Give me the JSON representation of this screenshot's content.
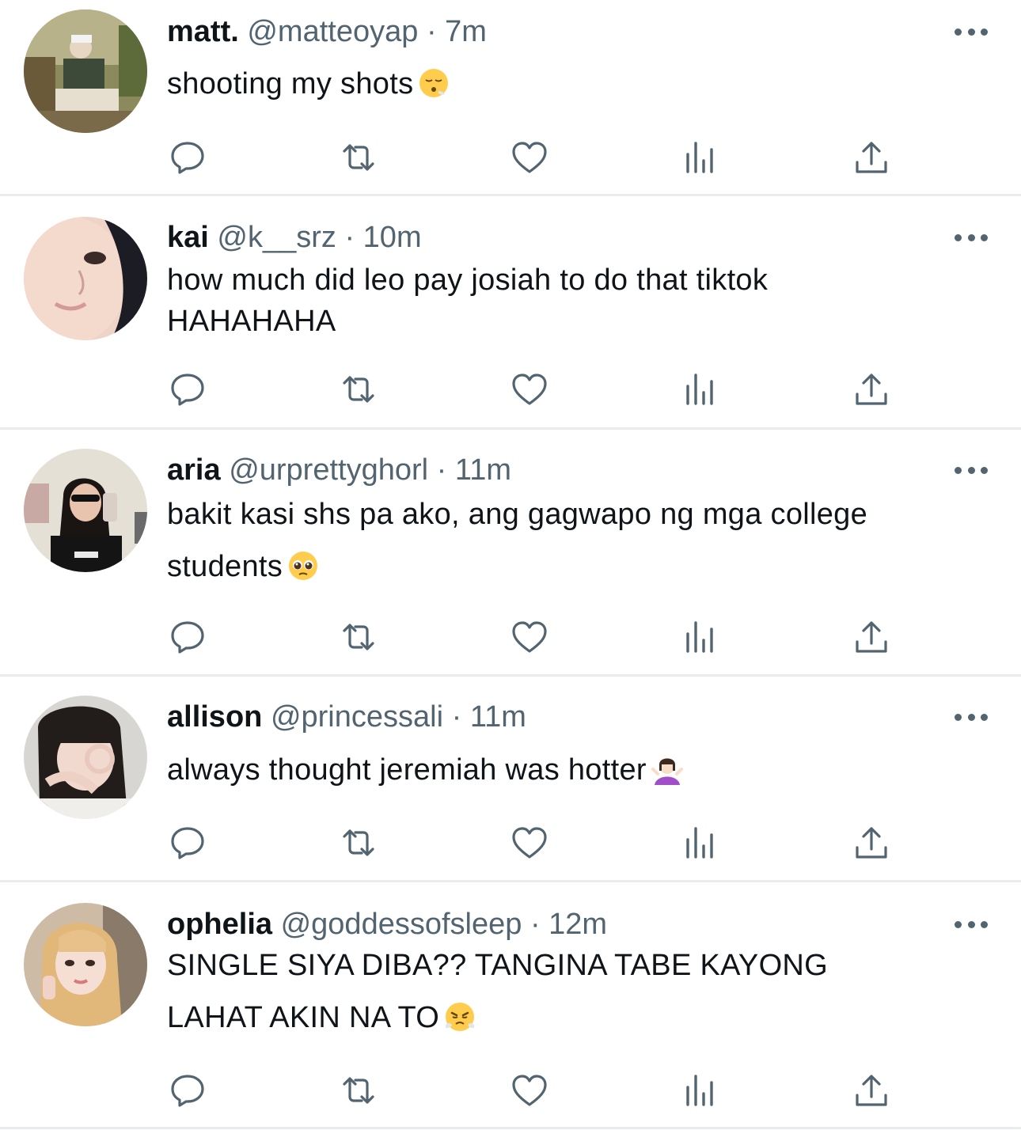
{
  "tweets": [
    {
      "name": "matt.",
      "handle": "@matteoyap",
      "separator": "·",
      "time": "7m",
      "lines": [
        "shooting my shots"
      ],
      "emoji": "face-exhaling"
    },
    {
      "name": "kai",
      "handle": "@k__srz",
      "separator": "·",
      "time": "10m",
      "lines": [
        "how much did leo pay josiah to do that tiktok",
        "HAHAHAHA"
      ],
      "emoji": ""
    },
    {
      "name": "aria",
      "handle": "@urprettyghorl",
      "separator": "·",
      "time": "11m",
      "lines": [
        "bakit kasi shs pa ako, ang gagwapo ng mga college",
        "students"
      ],
      "emoji": "pleading-face"
    },
    {
      "name": "allison",
      "handle": "@princessali",
      "separator": "·",
      "time": "11m",
      "lines": [
        "always thought jeremiah was hotter"
      ],
      "emoji": "woman-shrugging"
    },
    {
      "name": "ophelia",
      "handle": "@goddessofsleep",
      "separator": "·",
      "time": "12m",
      "lines": [
        "SINGLE SIYA DIBA?? TANGINA TABE KAYONG",
        "LAHAT AKIN NA TO"
      ],
      "emoji": "face-with-steam"
    }
  ],
  "action_icons": [
    "reply-icon",
    "retweet-icon",
    "like-icon",
    "views-icon",
    "share-icon"
  ],
  "colors": {
    "text": "#0f1419",
    "muted": "#536471",
    "icon": "#536471",
    "divider": "#e9ebed"
  }
}
